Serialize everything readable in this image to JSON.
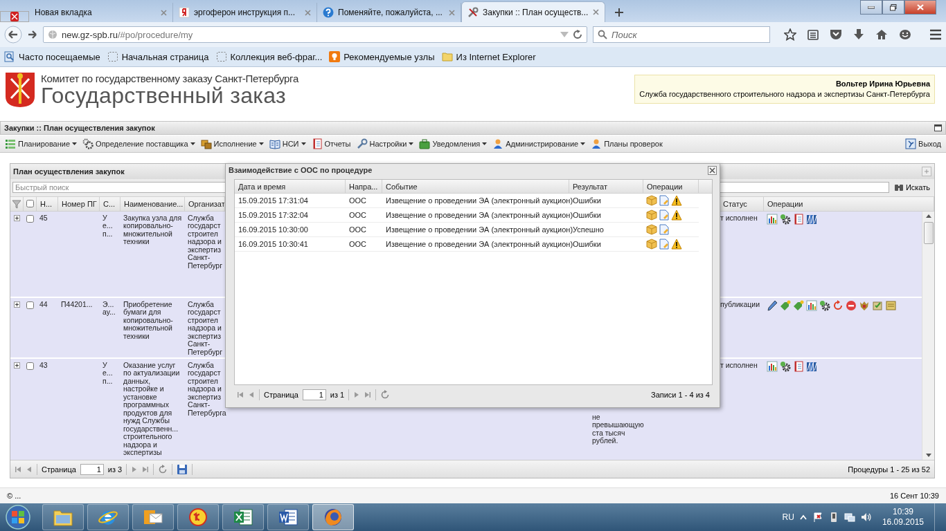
{
  "browser": {
    "tabs": [
      {
        "kind": "emblem",
        "selected": false
      },
      {
        "kind": "none",
        "title": "Новая вкладка",
        "selected": false
      },
      {
        "kind": "letter",
        "title": "эргоферон инструкция п...",
        "selected": false
      },
      {
        "kind": "help",
        "title": "Поменяйте, пожалуйста, ...",
        "selected": false
      },
      {
        "kind": "tools",
        "title": "Закупки :: План осуществ...",
        "selected": true
      }
    ],
    "url_host": "new.gz-spb.ru",
    "url_path": "/#po/procedure/my",
    "search_placeholder": "Поиск",
    "bookmarks": [
      {
        "kind": "smart",
        "label": "Часто посещаемые"
      },
      {
        "kind": "dashed",
        "label": "Начальная страница"
      },
      {
        "kind": "dashed",
        "label": "Коллекция веб-фраг..."
      },
      {
        "kind": "bulb",
        "label": "Рекомендуемые узлы"
      },
      {
        "kind": "folder",
        "label": "Из Internet Explorer"
      }
    ]
  },
  "header": {
    "org": "Комитет по государственному заказу Санкт-Петербурга",
    "title": "Государственный заказ",
    "user": "Вольтер Ирина Юрьевна",
    "department": "Служба государственного строительного надзора и экспертизы Санкт-Петербурга"
  },
  "app_title": "Закупки :: План осуществления закупок",
  "menu": [
    {
      "kind": "planning",
      "label": "Планирование",
      "dropdown": true
    },
    {
      "kind": "supplier",
      "label": "Определение поставщика",
      "dropdown": true
    },
    {
      "kind": "execution",
      "label": "Исполнение",
      "dropdown": true
    },
    {
      "kind": "book",
      "label": "НСИ",
      "dropdown": true
    },
    {
      "kind": "report",
      "label": "Отчеты",
      "dropdown": false
    },
    {
      "kind": "wrench",
      "label": "Настройки",
      "dropdown": true
    },
    {
      "kind": "notify",
      "label": "Уведомления",
      "dropdown": true
    },
    {
      "kind": "user",
      "label": "Администрирование",
      "dropdown": true
    },
    {
      "kind": "user",
      "label": "Планы проверок",
      "dropdown": false
    }
  ],
  "logout": "Выход",
  "panel": {
    "title": "План осуществления закупок",
    "search_placeholder": "Быстрый поиск",
    "search_button": "Искать",
    "all_checked": false,
    "columns": [
      "Н...",
      "Номер ПГ",
      "С...",
      "Наименование...",
      "Организат",
      "Статус",
      "Операции"
    ],
    "rows": [
      {
        "expanded": false,
        "checked": false,
        "number": "45",
        "method": "У\nе...\nп...",
        "name": "Закупка узла для\nкопировально-\nмножительной\nтехники",
        "organizer": "Служба\nгосударст\nстроител\nнадзора и\nэкспертиз\nСанкт-\nПетербург",
        "status": "т исполнен",
        "operations": [
          {
            "kind": "chart"
          },
          {
            "kind": "gear"
          },
          {
            "kind": "report"
          },
          {
            "kind": "binders"
          }
        ]
      },
      {
        "expanded": false,
        "checked": false,
        "number": "44",
        "plan_number": "П44201...",
        "method": "Э...\nау...",
        "name": "Приобретение\nбумаги для\nкопировально-\nмножительной\nтехники",
        "organizer": "Служба\nгосударст\nстроител\nнадзора и\nэкспертиз\nСанкт-\nПетербург",
        "status": "публикации",
        "operations": [
          {
            "kind": "pencil"
          },
          {
            "kind": "tag"
          },
          {
            "kind": "tag"
          },
          {
            "kind": "chart"
          },
          {
            "kind": "gear"
          },
          {
            "kind": "refresh"
          },
          {
            "kind": "stop"
          },
          {
            "kind": "emblem"
          },
          {
            "kind": "approve"
          },
          {
            "kind": "scroll"
          }
        ]
      },
      {
        "expanded": false,
        "checked": false,
        "number": "43",
        "method": "У\nе...\nп...",
        "name": "Оказание услуг\nпо актуализации\nданных,\nнастройке и\nустановке\nпрограммных\nпродуктов для\nнужд Службы\nгосударственн...\nстроительного\nнадзора и\nэкспертизы",
        "organizer": "Служба\nгосударст\nстроител\nнадзора и\nэкспертиз\nСанкт-\nПетербурга",
        "note": "не\nпревышающую\nста тысяч\nрублей.",
        "status": "т исполнен",
        "operations": [
          {
            "kind": "chart"
          },
          {
            "kind": "gear"
          },
          {
            "kind": "report"
          },
          {
            "kind": "binders"
          }
        ]
      }
    ],
    "pager": {
      "page_label": "Страница",
      "page": "1",
      "of": "из 3",
      "summary": "Процедуры 1 - 25 из 52"
    }
  },
  "dialog": {
    "title": "Взаимодействие с ООС по процедуре",
    "columns": [
      "Дата и время",
      "Напра...",
      "Событие",
      "Результат",
      "Операции"
    ],
    "rows": [
      {
        "datetime": "15.09.2015 17:31:04",
        "direction": "ООС",
        "event": "Извещение о проведении ЭА (электронный аукцион)",
        "result": "Ошибки",
        "operations": [
          {
            "kind": "package"
          },
          {
            "kind": "document"
          },
          {
            "kind": "warning"
          }
        ]
      },
      {
        "datetime": "15.09.2015 17:32:04",
        "direction": "ООС",
        "event": "Извещение о проведении ЭА (электронный аукцион)",
        "result": "Ошибки",
        "operations": [
          {
            "kind": "package"
          },
          {
            "kind": "document"
          },
          {
            "kind": "warning"
          }
        ]
      },
      {
        "datetime": "16.09.2015 10:30:00",
        "direction": "ООС",
        "event": "Извещение о проведении ЭА (электронный аукцион)",
        "result": "Успешно",
        "operations": [
          {
            "kind": "package"
          },
          {
            "kind": "document"
          }
        ]
      },
      {
        "datetime": "16.09.2015 10:30:41",
        "direction": "ООС",
        "event": "Извещение о проведении ЭА (электронный аукцион)",
        "result": "Ошибки",
        "operations": [
          {
            "kind": "package"
          },
          {
            "kind": "document"
          },
          {
            "kind": "warning"
          }
        ]
      }
    ],
    "pager": {
      "page_label": "Страница",
      "page": "1",
      "of": "из 1",
      "summary": "Записи 1 - 4 из 4"
    }
  },
  "status_bar": {
    "left": "© ...",
    "right": "16 Сент 10:39"
  },
  "taskbar": {
    "apps": [
      {
        "kind": "folder",
        "selected": false
      },
      {
        "kind": "browser_e",
        "selected": false
      },
      {
        "kind": "mail",
        "selected": false
      },
      {
        "kind": "accounting",
        "selected": false
      },
      {
        "kind": "sheet",
        "selected": false
      },
      {
        "kind": "word",
        "selected": false
      },
      {
        "kind": "fox",
        "selected": true
      }
    ],
    "language": "RU",
    "time": "10:39",
    "date": "16.09.2015"
  }
}
